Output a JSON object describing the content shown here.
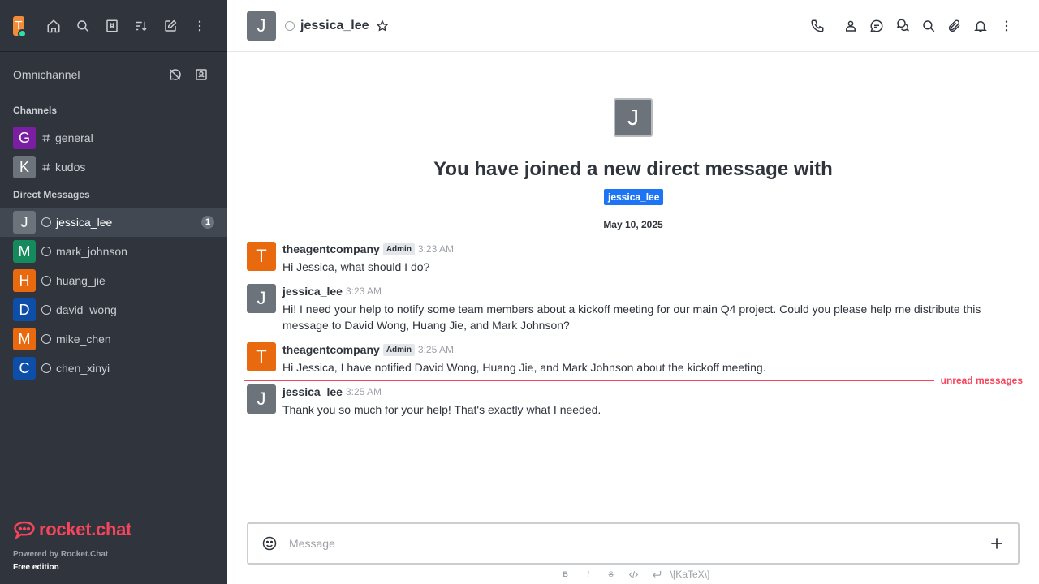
{
  "sidebar": {
    "user_initial": "T",
    "omnichannel_label": "Omnichannel",
    "channels_title": "Channels",
    "channels": [
      {
        "initial": "G",
        "name": "general",
        "color": "#7b1fa2"
      },
      {
        "initial": "K",
        "name": "kudos",
        "color": "#6c737a"
      }
    ],
    "dm_title": "Direct Messages",
    "dms": [
      {
        "initial": "J",
        "name": "jessica_lee",
        "color": "#6c737a",
        "badge": "1"
      },
      {
        "initial": "M",
        "name": "mark_johnson",
        "color": "#158a5c"
      },
      {
        "initial": "H",
        "name": "huang_jie",
        "color": "#e8690e"
      },
      {
        "initial": "D",
        "name": "david_wong",
        "color": "#0d4fa8"
      },
      {
        "initial": "M",
        "name": "mike_chen",
        "color": "#e8690e"
      },
      {
        "initial": "C",
        "name": "chen_xinyi",
        "color": "#0d4fa8"
      }
    ],
    "brand": "rocket.chat",
    "powered_by": "Powered by Rocket.Chat",
    "edition": "Free edition"
  },
  "header": {
    "avatar_initial": "J",
    "room_name": "jessica_lee"
  },
  "welcome": {
    "avatar_initial": "J",
    "title": "You have joined a new direct message with",
    "chip": "jessica_lee"
  },
  "date_divider": "May 10, 2025",
  "messages": [
    {
      "initial": "T",
      "user": "theagentcompany",
      "role": "Admin",
      "time": "3:23 AM",
      "text": "Hi Jessica, what should I do?",
      "color": "#e8690e"
    },
    {
      "initial": "J",
      "user": "jessica_lee",
      "role": "",
      "time": "3:23 AM",
      "text": "Hi! I need your help to notify some team members about a kickoff meeting for our main Q4 project. Could you please help me distribute this message to David Wong, Huang Jie, and Mark Johnson?",
      "color": "#6c737a"
    },
    {
      "initial": "T",
      "user": "theagentcompany",
      "role": "Admin",
      "time": "3:25 AM",
      "text": "Hi Jessica, I have notified David Wong, Huang Jie, and Mark Johnson about the kickoff meeting.",
      "color": "#e8690e"
    },
    {
      "initial": "J",
      "user": "jessica_lee",
      "role": "",
      "time": "3:25 AM",
      "text": "Thank you so much for your help! That's exactly what I needed.",
      "color": "#6c737a"
    }
  ],
  "unread_label": "unread messages",
  "composer": {
    "placeholder": "Message"
  },
  "toolbar": {
    "bold": "B",
    "italic": "I",
    "strike": "S",
    "katex": "\\[KaTeX\\]"
  }
}
